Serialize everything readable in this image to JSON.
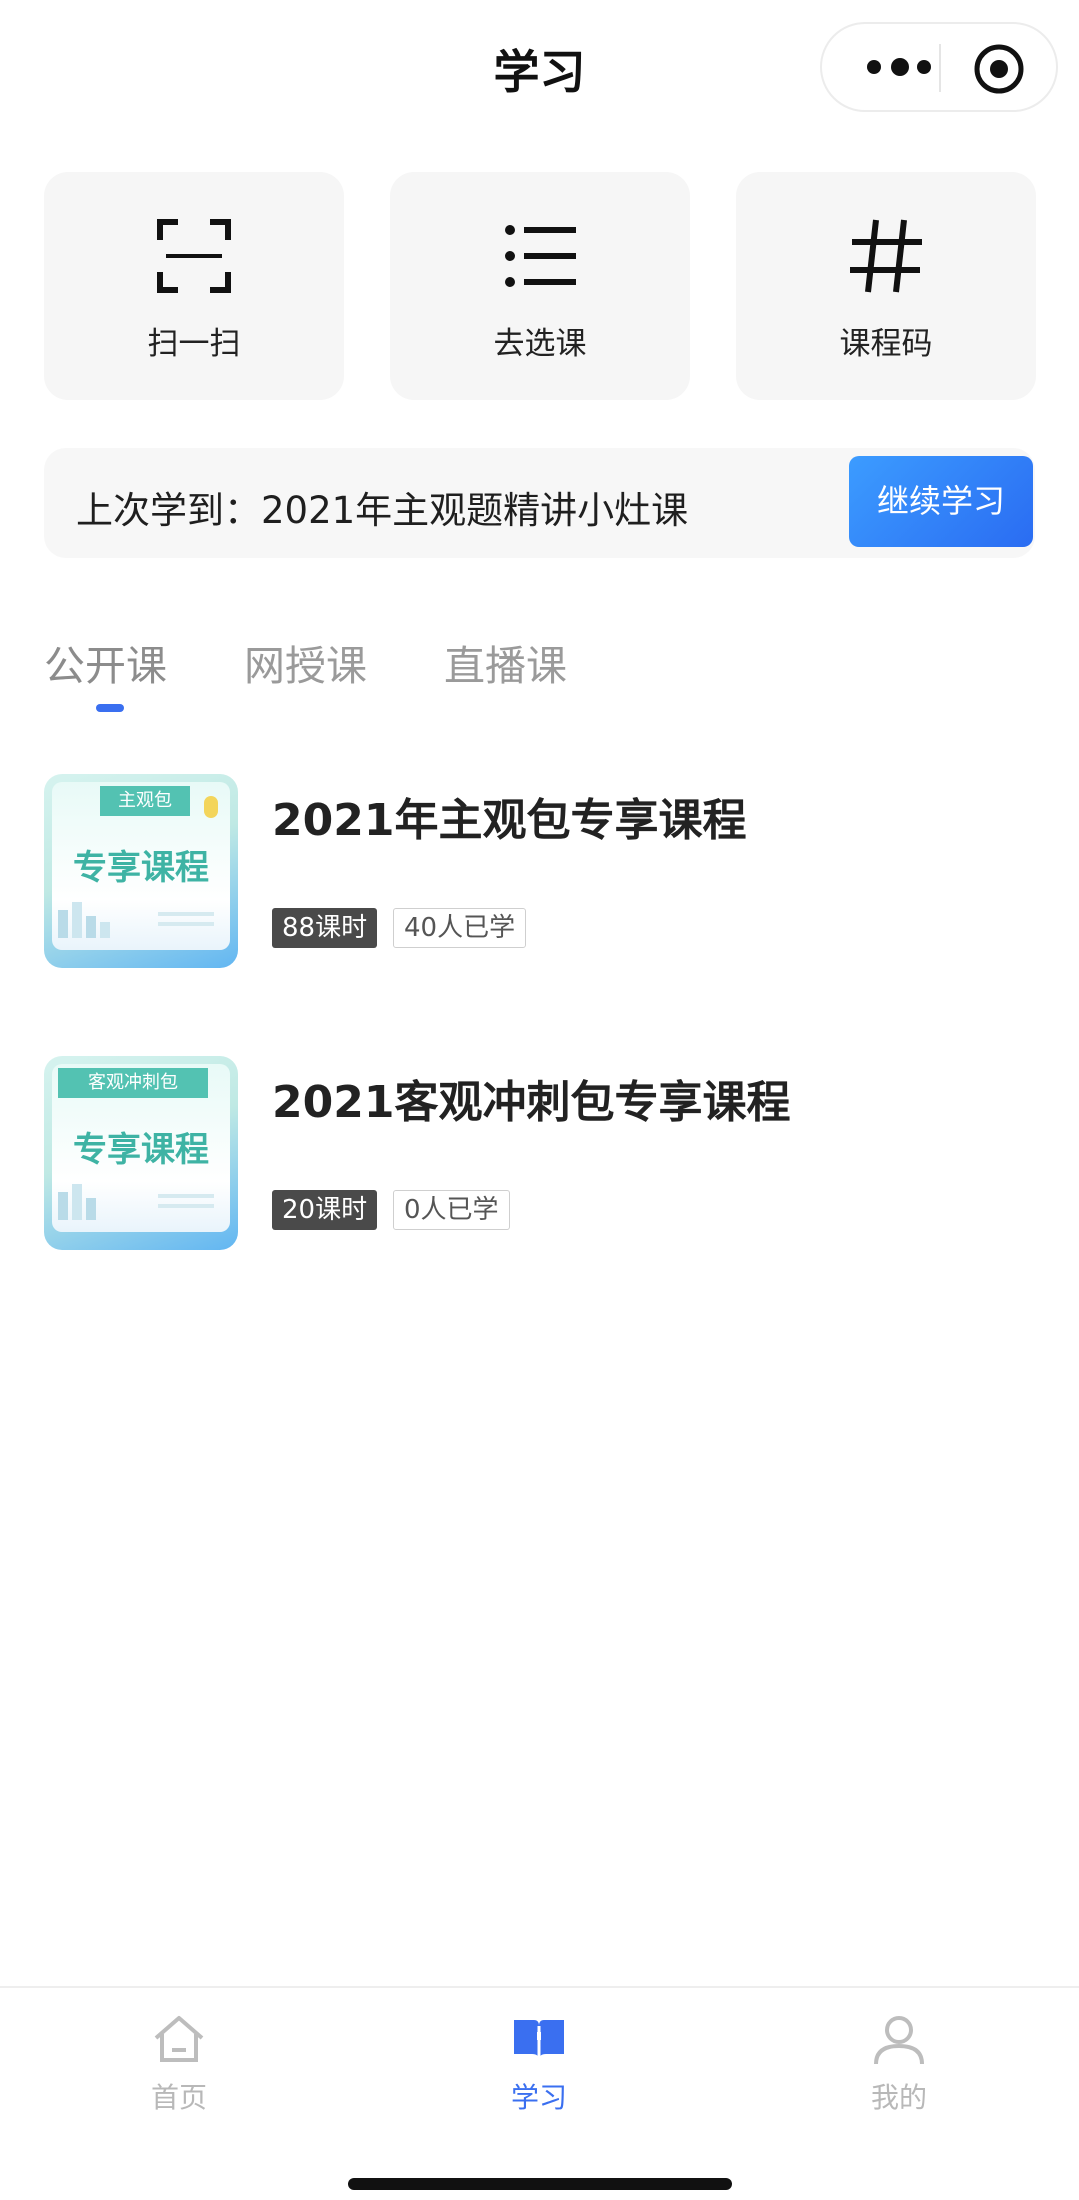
{
  "header": {
    "title": "学习"
  },
  "quick_actions": [
    {
      "label": "扫一扫",
      "icon": "scan-icon"
    },
    {
      "label": "去选课",
      "icon": "list-icon"
    },
    {
      "label": "课程码",
      "icon": "hash-icon"
    }
  ],
  "last_study": {
    "text": "上次学到：2021年主观题精讲小灶课",
    "button_label": "继续学习"
  },
  "tabs": [
    {
      "label": "公开课",
      "active": true
    },
    {
      "label": "网授课",
      "active": false
    },
    {
      "label": "直播课",
      "active": false
    }
  ],
  "courses": [
    {
      "title": "2021年主观包专享课程",
      "lessons": "88课时",
      "learners": "40人已学",
      "thumb_banner": "主观包",
      "thumb_text": "专享课程"
    },
    {
      "title": "2021客观冲刺包专享课程",
      "lessons": "20课时",
      "learners": "0人已学",
      "thumb_banner": "客观冲刺包",
      "thumb_text": "专享课程"
    }
  ],
  "tabbar": [
    {
      "label": "首页",
      "icon": "home-icon",
      "active": false
    },
    {
      "label": "学习",
      "icon": "book-icon",
      "active": true
    },
    {
      "label": "我的",
      "icon": "user-icon",
      "active": false
    }
  ],
  "colors": {
    "accent": "#3a6ff0",
    "button_gradient_start": "#3c9cff",
    "tag_dark": "#4a4a4a"
  }
}
